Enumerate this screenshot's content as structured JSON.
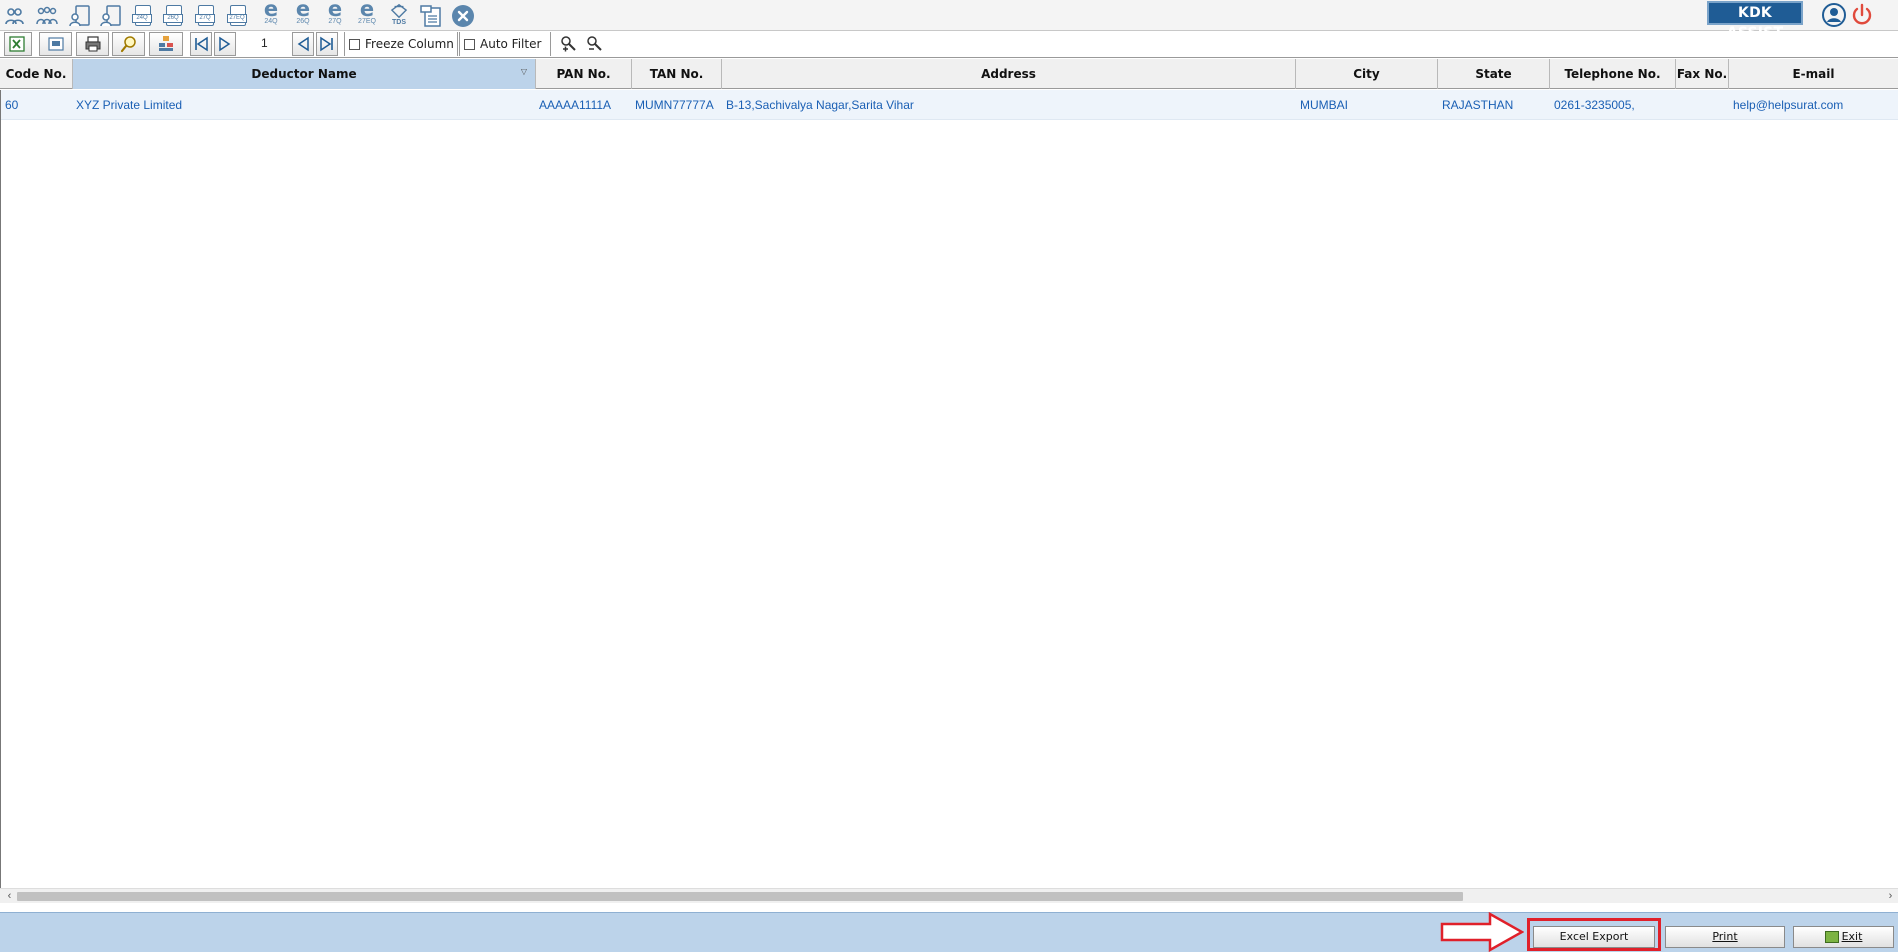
{
  "toolbar": {
    "icons": [
      {
        "name": "deductor-icon"
      },
      {
        "name": "deductor-group-icon"
      },
      {
        "name": "employee-icon"
      },
      {
        "name": "party-icon"
      }
    ],
    "form_icons": [
      {
        "name": "form-24q-icon",
        "tag": "24Q"
      },
      {
        "name": "form-26q-icon",
        "tag": "26Q"
      },
      {
        "name": "form-27q-icon",
        "tag": "27Q"
      },
      {
        "name": "form-27eq-icon",
        "tag": "27EQ"
      }
    ],
    "e_icons": [
      {
        "name": "e-24q-icon",
        "glyph": "e",
        "sub": "24Q"
      },
      {
        "name": "e-26q-icon",
        "glyph": "e",
        "sub": "26Q"
      },
      {
        "name": "e-27q-icon",
        "glyph": "e",
        "sub": "27Q"
      },
      {
        "name": "e-27eq-icon",
        "glyph": "e",
        "sub": "27EQ"
      }
    ],
    "tds_label": "TDS",
    "brand_button": "KDK ASSIST"
  },
  "grid_toolbar": {
    "page_number": "1",
    "freeze_column": "Freeze Column",
    "auto_filter": "Auto Filter"
  },
  "grid": {
    "columns": [
      {
        "key": "code",
        "label": "Code No."
      },
      {
        "key": "name",
        "label": "Deductor Name"
      },
      {
        "key": "pan",
        "label": "PAN No."
      },
      {
        "key": "tan",
        "label": "TAN No."
      },
      {
        "key": "address",
        "label": "Address"
      },
      {
        "key": "city",
        "label": "City"
      },
      {
        "key": "state",
        "label": "State"
      },
      {
        "key": "phone",
        "label": "Telephone No."
      },
      {
        "key": "fax",
        "label": "Fax No."
      },
      {
        "key": "email",
        "label": "E-mail"
      }
    ],
    "rows": [
      {
        "code": "60",
        "name": "XYZ Private Limited",
        "pan": "AAAAA1111A",
        "tan": "MUMN77777A",
        "address": "B-13,Sachivalya Nagar,Sarita Vihar",
        "city": "MUMBAI",
        "state": "RAJASTHAN",
        "phone": "0261-3235005,",
        "fax": "",
        "email": "help@helpsurat.com"
      }
    ]
  },
  "footer": {
    "excel_export": "Excel Export",
    "print": "Print",
    "exit": "Exit"
  },
  "colors": {
    "accent": "#1f5c95",
    "header_sorted": "#bcd3ea",
    "row_text": "#1a5fb4",
    "highlight": "#e0202a"
  }
}
